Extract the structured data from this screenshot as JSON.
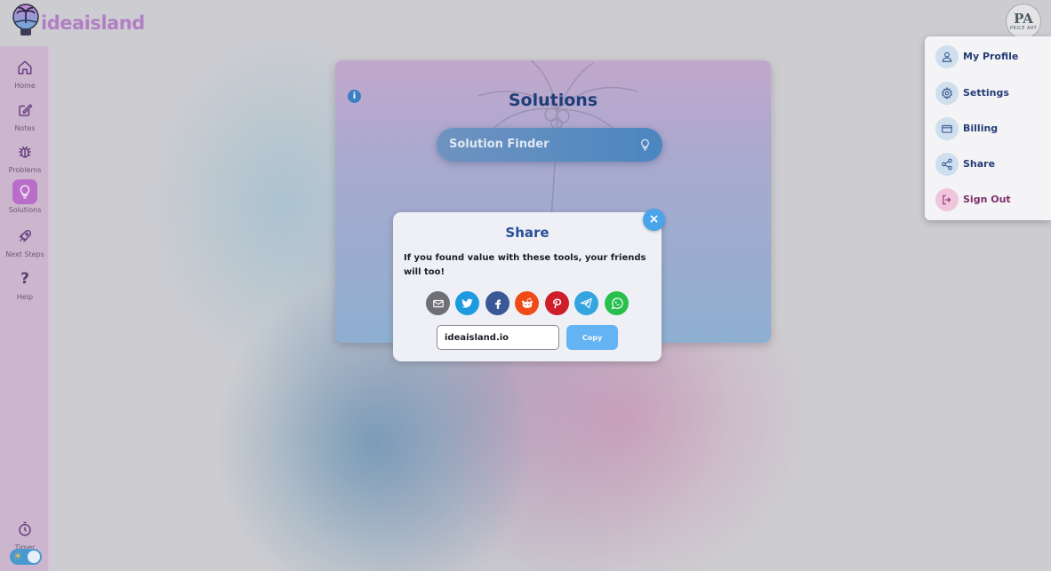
{
  "app": {
    "brand": "ideaisland"
  },
  "header": {
    "avatar_initials": "PA",
    "avatar_subtext": "PRICE ART"
  },
  "sidebar": {
    "items": [
      {
        "label": "Home",
        "icon": "home-icon"
      },
      {
        "label": "Notes",
        "icon": "edit-icon"
      },
      {
        "label": "Problems",
        "icon": "bug-icon"
      },
      {
        "label": "Solutions",
        "icon": "lightbulb-icon",
        "active": true
      },
      {
        "label": "Next Steps",
        "icon": "rocket-icon"
      },
      {
        "label": "Help",
        "icon": "question-icon"
      }
    ],
    "timer_label": "Timer",
    "theme_toggle": "sun-icon"
  },
  "card": {
    "title": "Solutions",
    "finder_label": "Solution Finder"
  },
  "share_modal": {
    "title": "Share",
    "message": "If you found value with these tools, your friends will too!",
    "close_label": "×",
    "socials": [
      {
        "name": "email",
        "color": "#6f6f76"
      },
      {
        "name": "twitter",
        "color": "#1d9ae0"
      },
      {
        "name": "facebook",
        "color": "#3a5796"
      },
      {
        "name": "reddit",
        "color": "#f04a17"
      },
      {
        "name": "pinterest",
        "color": "#cf1d2a"
      },
      {
        "name": "telegram",
        "color": "#34a5de"
      },
      {
        "name": "whatsapp",
        "color": "#27c04c"
      }
    ],
    "url_value": "ideaisland.io",
    "copy_label": "Copy"
  },
  "dropdown": {
    "items": [
      {
        "label": "My Profile",
        "icon": "user-icon"
      },
      {
        "label": "Settings",
        "icon": "gear-icon"
      },
      {
        "label": "Billing",
        "icon": "credit-card-icon"
      },
      {
        "label": "Share",
        "icon": "share-icon"
      },
      {
        "label": "Sign Out",
        "icon": "sign-out-icon"
      }
    ]
  }
}
